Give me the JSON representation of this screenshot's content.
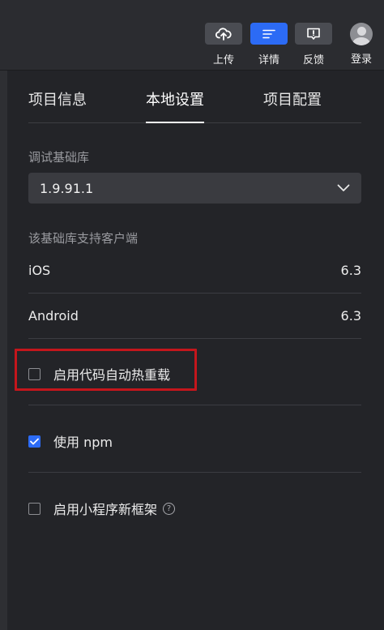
{
  "toolbar": {
    "upload": {
      "label": "上传",
      "icon": "cloud-upload-icon"
    },
    "details": {
      "label": "详情",
      "icon": "details-lines-icon",
      "active": true
    },
    "feedback": {
      "label": "反馈",
      "icon": "feedback-icon"
    },
    "login": {
      "label": "登录",
      "icon": "avatar-icon"
    }
  },
  "tabs": [
    {
      "label": "项目信息",
      "active": false
    },
    {
      "label": "本地设置",
      "active": true
    },
    {
      "label": "项目配置",
      "active": false
    }
  ],
  "debug_library": {
    "label": "调试基础库",
    "selected": "1.9.91.1"
  },
  "client_support": {
    "label": "该基础库支持客户端",
    "rows": [
      {
        "platform": "iOS",
        "version": "6.3"
      },
      {
        "platform": "Android",
        "version": "6.3"
      }
    ]
  },
  "options": [
    {
      "label": "启用代码自动热重载",
      "checked": false,
      "highlighted": true
    },
    {
      "label": "使用 npm",
      "checked": true
    },
    {
      "label": "启用小程序新框架",
      "checked": false,
      "help": "?"
    }
  ],
  "colors": {
    "accent": "#2c6bf5",
    "highlight": "#c4161c",
    "background": "#232428"
  }
}
